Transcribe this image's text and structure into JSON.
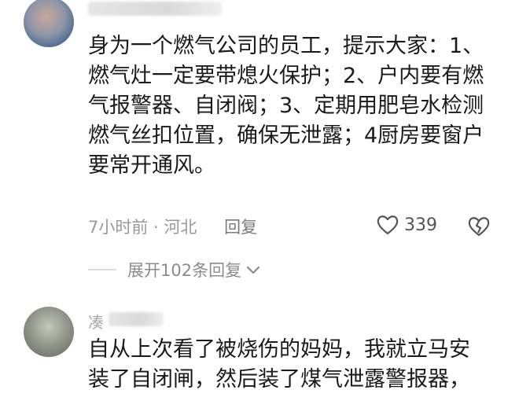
{
  "comments": [
    {
      "text": "身为一个燃气公司的员工，提示大家：1、\n燃气灶一定要带熄火保护；2、户内要有燃\n气报警器、自闭阀；3、定期用肥皂水检测\n燃气丝扣位置，确保无泄露；4厨房要窗户\n要常开通风。",
      "time_location": "7小时前 · 河北",
      "reply_label": "回复",
      "likes": "339",
      "expand_label": "展开102条回复"
    },
    {
      "username_visible": "凑",
      "text": "自从上次看了被烧伤的妈妈，我就立马安\n装了自闭闸，然后装了煤气泄露警报器，"
    }
  ],
  "icons": {
    "like": "heart-outline-icon",
    "dislike": "broken-heart-icon",
    "expand": "chevron-down-icon"
  },
  "colors": {
    "text": "#1a1a1a",
    "meta": "#999999"
  }
}
